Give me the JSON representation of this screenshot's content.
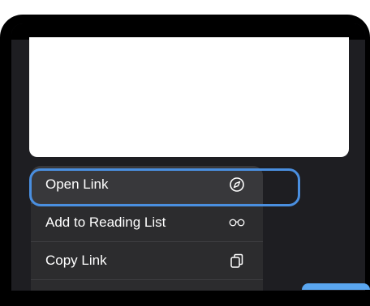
{
  "menu": {
    "items": [
      {
        "label": "Open Link",
        "icon": "compass-icon"
      },
      {
        "label": "Add to Reading List",
        "icon": "glasses-icon"
      },
      {
        "label": "Copy Link",
        "icon": "copy-icon"
      },
      {
        "label": "",
        "icon": "share-icon"
      }
    ]
  },
  "colors": {
    "highlight": "#4a8fe0",
    "menu_background": "#2c2c2e",
    "screen_background": "#1e1e22",
    "frame": "#000000"
  }
}
